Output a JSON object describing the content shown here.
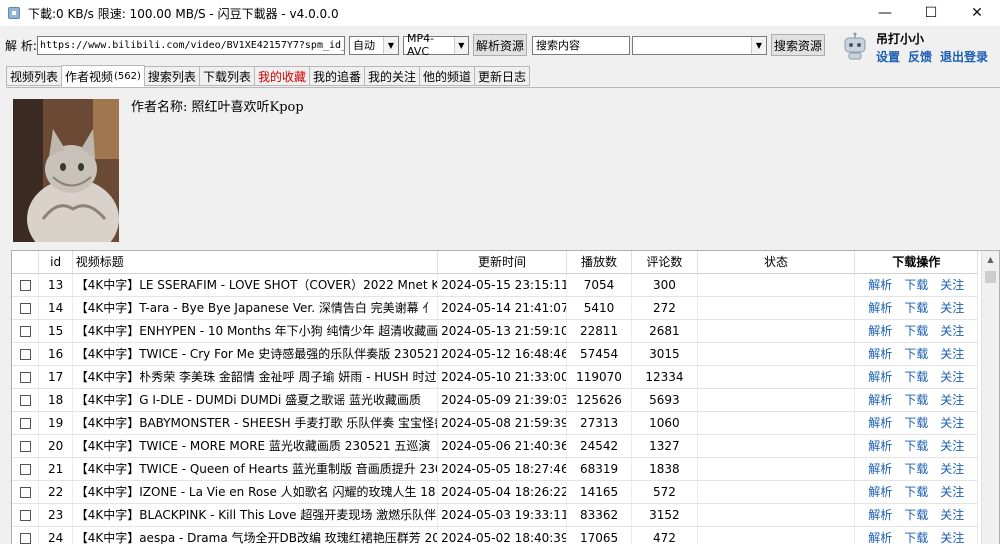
{
  "window": {
    "title": "下載:0 KB/s  限速: 100.00 MB/S  - 闪豆下載器 - v4.0.0.0",
    "minimize_icon": "—",
    "maximize_icon": "☐",
    "close_icon": "✕"
  },
  "toolbar": {
    "parse_label": "解 析:",
    "url_value": "https://www.bilibili.com/video/BV1XE42157Y7?spm_id_fr",
    "mode_value": "自动",
    "format_value": "MP4-AVC",
    "parse_button": "解析资源",
    "search_placeholder": "搜索内容",
    "search_combo_value": "",
    "search_button": "搜索资源",
    "combo_arrow": "▼"
  },
  "user": {
    "name": "吊打小小",
    "settings": "设置",
    "feedback": "反馈",
    "logout": "退出登录"
  },
  "tabs": [
    {
      "label": "视频列表",
      "count": ""
    },
    {
      "label": "作者视频",
      "count": "(562)"
    },
    {
      "label": "搜索列表",
      "count": ""
    },
    {
      "label": "下载列表",
      "count": ""
    },
    {
      "label": "我的收藏",
      "count": ""
    },
    {
      "label": "我的追番",
      "count": ""
    },
    {
      "label": "我的关注",
      "count": ""
    },
    {
      "label": "他的频道",
      "count": ""
    },
    {
      "label": "更新日志",
      "count": ""
    }
  ],
  "author": {
    "name_label": "作者名称: 照红叶喜欢听Kpop"
  },
  "table": {
    "headers": {
      "id": "id",
      "title": "视频标题",
      "updated": "更新时间",
      "plays": "播放数",
      "comments": "评论数",
      "status": "状态",
      "actions": "下载操作"
    },
    "action_labels": [
      "解析",
      "下载",
      "关注"
    ],
    "rows": [
      {
        "id": "13",
        "title": "【4K中字】LE SSERAFIM - LOVE SHOT（COVER）2022 Mnet K",
        "time": "2024-05-15 23:15:11",
        "plays": "7054",
        "comments": "300",
        "status": ""
      },
      {
        "id": "14",
        "title": "【4K中字】T-ara - Bye Bye  Japanese Ver.  深情告白 完美谢幕 亻",
        "time": "2024-05-14 21:41:07",
        "plays": "5410",
        "comments": "272",
        "status": ""
      },
      {
        "id": "15",
        "title": "【4K中字】ENHYPEN - 10 Months 年下小狗 纯情少年 超清收藏画",
        "time": "2024-05-13 21:59:10",
        "plays": "22811",
        "comments": "2681",
        "status": ""
      },
      {
        "id": "16",
        "title": "【4K中字】TWICE - Cry For Me 史诗感最强的乐队伴奏版 230521",
        "time": "2024-05-12 16:48:46",
        "plays": "57454",
        "comments": "3015",
        "status": ""
      },
      {
        "id": "17",
        "title": "【4K中字】朴秀荣 李美珠 金韶情 金祉呼 周子瑜 妍雨 - HUSH 时过",
        "time": "2024-05-10 21:33:00",
        "plays": "119070",
        "comments": "12334",
        "status": ""
      },
      {
        "id": "18",
        "title": "【4K中字】G I-DLE - DUMDi DUMDi 盛夏之歌谣 蓝光收藏画质",
        "time": "2024-05-09 21:39:03",
        "plays": "125626",
        "comments": "5693",
        "status": ""
      },
      {
        "id": "19",
        "title": "【4K中字】BABYMONSTER - SHEESH 手麦打歌 乐队伴奏 宝宝怪兽",
        "time": "2024-05-08 21:59:39",
        "plays": "27313",
        "comments": "1060",
        "status": ""
      },
      {
        "id": "20",
        "title": "【4K中字】TWICE - MORE   MORE 蓝光收藏画质 230521 五巡演",
        "time": "2024-05-06 21:40:36",
        "plays": "24542",
        "comments": "1327",
        "status": ""
      },
      {
        "id": "21",
        "title": "【4K中字】TWICE - Queen of Hearts 蓝光重制版 音画质提升 230",
        "time": "2024-05-05 18:27:46",
        "plays": "68319",
        "comments": "1838",
        "status": ""
      },
      {
        "id": "22",
        "title": "【4K中字】IZONE - La Vie en Rose 人如歌名 闪耀的玫瑰人生 18",
        "time": "2024-05-04 18:26:22",
        "plays": "14165",
        "comments": "572",
        "status": ""
      },
      {
        "id": "23",
        "title": "【4K中字】BLACKPINK - Kill This Love 超强开麦现场 激燃乐队伴",
        "time": "2024-05-03 19:33:11",
        "plays": "83362",
        "comments": "3152",
        "status": ""
      },
      {
        "id": "24",
        "title": "【4K中字】aespa - Drama 气场全开DB改编 玫瑰红裙艳压群芳 20",
        "time": "2024-05-02 18:40:39",
        "plays": "17065",
        "comments": "472",
        "status": ""
      }
    ]
  },
  "colors": {
    "link": "#1a5fb4",
    "red_tab": "#d10000"
  }
}
